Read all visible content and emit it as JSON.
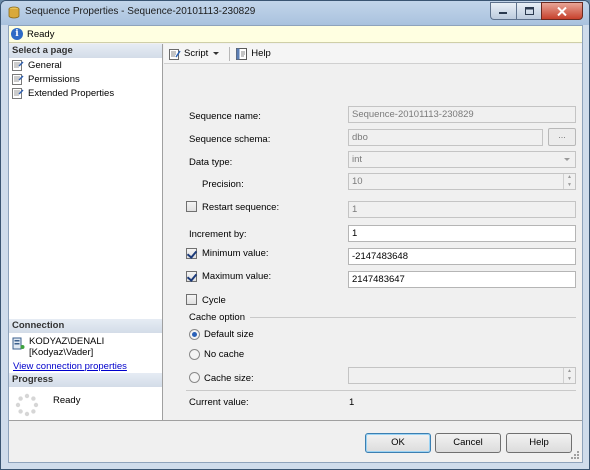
{
  "window": {
    "title": "Sequence Properties - Sequence-20101113-230829"
  },
  "status": {
    "text": "Ready"
  },
  "select_page": {
    "header": "Select a page",
    "items": [
      {
        "label": "General",
        "icon": "page-icon"
      },
      {
        "label": "Permissions",
        "icon": "page-icon"
      },
      {
        "label": "Extended Properties",
        "icon": "page-icon"
      }
    ]
  },
  "connection": {
    "header": "Connection",
    "server": "KODYAZ\\DENALI",
    "user": "[Kodyaz\\Vader]",
    "link": "View connection properties"
  },
  "progress": {
    "header": "Progress",
    "status": "Ready"
  },
  "toolbar": {
    "script_label": "Script",
    "help_label": "Help"
  },
  "form": {
    "sequence_name_label": "Sequence name:",
    "sequence_name_value": "Sequence-20101113-230829",
    "sequence_schema_label": "Sequence schema:",
    "sequence_schema_value": "dbo",
    "browse_label": "...",
    "data_type_label": "Data type:",
    "data_type_value": "int",
    "precision_label": "Precision:",
    "precision_value": "10",
    "restart_label": "Restart sequence:",
    "restart_checked": false,
    "restart_value": "1",
    "increment_label": "Increment by:",
    "increment_value": "1",
    "min_label": "Minimum value:",
    "min_checked": true,
    "min_value": "-2147483648",
    "max_label": "Maximum value:",
    "max_checked": true,
    "max_value": "2147483647",
    "cycle_label": "Cycle",
    "cycle_checked": false,
    "cache_option_label": "Cache option",
    "default_size_label": "Default size",
    "no_cache_label": "No cache",
    "cache_size_label": "Cache size:",
    "cache_size_value": "",
    "selected_cache_option": "Default size",
    "current_value_label": "Current value:",
    "current_value": "1"
  },
  "buttons": {
    "ok": "OK",
    "cancel": "Cancel",
    "help": "Help"
  },
  "colors": {
    "link": "#0000cc",
    "title_bar": "#b4c9e2",
    "status_bar": "#ffffe1",
    "close_button": "#c7412c"
  }
}
